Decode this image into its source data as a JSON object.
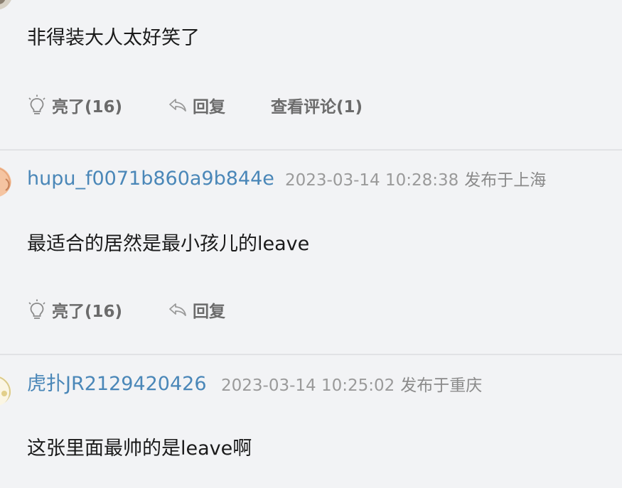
{
  "comments": [
    {
      "content": "非得装大人太好笑了",
      "actions": {
        "like_label": "亮了(16)",
        "reply_label": "回复",
        "view_replies_label": "查看评论(1)"
      }
    },
    {
      "username": "hupu_f0071b860a9b844e",
      "time": "2023-03-14 10:28:38",
      "location": "发布于上海",
      "content": "最适合的居然是最小孩儿的leave",
      "actions": {
        "like_label": "亮了(16)",
        "reply_label": "回复"
      }
    },
    {
      "username": "虎扑JR2129420426",
      "time": "2023-03-14 10:25:02",
      "location": "发布于重庆",
      "content": "这张里面最帅的是leave啊"
    }
  ],
  "icons": {
    "like": "lightbulb-icon",
    "reply": "reply-arrow-icon"
  },
  "colors": {
    "background": "#f2f3f5",
    "username": "#4a87b8",
    "meta": "#9a9a9a",
    "content": "#1a1a1a",
    "action": "#6b6b6b",
    "divider": "#e1e2e5"
  }
}
